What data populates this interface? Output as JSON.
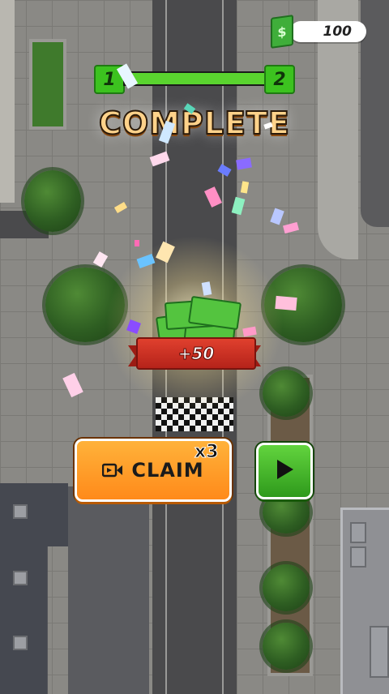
{
  "hud": {
    "money_value": "100",
    "money_icon": "cash-icon"
  },
  "level_progress": {
    "current_level": "1",
    "next_level": "2",
    "progress": 1.0
  },
  "title": "COMPLETE",
  "reward": {
    "text": "+50",
    "icon": "cash-stack-icon"
  },
  "actions": {
    "claim_label": "CLAIM",
    "claim_multiplier": "x3",
    "claim_icon": "video-camera-icon",
    "next_icon": "play-icon"
  },
  "colors": {
    "accent_orange": "#ff9a2a",
    "accent_green": "#3cc21f",
    "ribbon_red": "#d0332a"
  }
}
